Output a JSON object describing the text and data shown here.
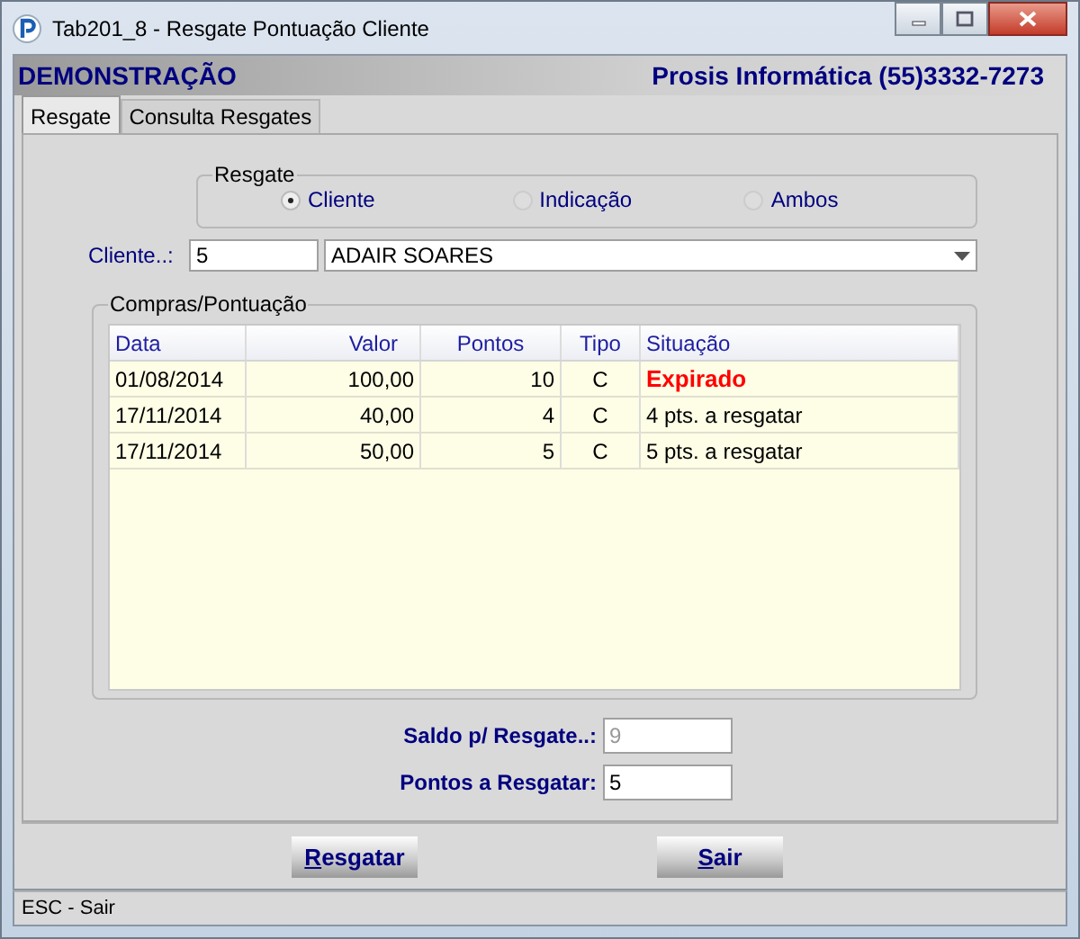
{
  "window": {
    "title": "Tab201_8 - Resgate Pontuação Cliente"
  },
  "header": {
    "left": "DEMONSTRAÇÃO",
    "right": "Prosis Informática (55)3332-7273"
  },
  "tabs": [
    {
      "label": "Resgate",
      "selected": true
    },
    {
      "label": "Consulta Resgates",
      "selected": false
    }
  ],
  "resgate_group": {
    "title": "Resgate",
    "options": [
      {
        "label": "Cliente",
        "selected": true
      },
      {
        "label": "Indicação",
        "selected": false
      },
      {
        "label": "Ambos",
        "selected": false
      }
    ]
  },
  "cliente": {
    "label": "Cliente..:",
    "code": "5",
    "name": "ADAIR SOARES"
  },
  "compras": {
    "title": "Compras/Pontuação",
    "columns": [
      "Data",
      "Valor",
      "Pontos",
      "Tipo",
      "Situação"
    ],
    "rows": [
      {
        "cells": [
          "01/08/2014",
          "100,00",
          "10",
          "C",
          "Expirado"
        ],
        "expired": true
      },
      {
        "cells": [
          "17/11/2014",
          "40,00",
          "4",
          "C",
          "4 pts. a resgatar"
        ],
        "expired": false
      },
      {
        "cells": [
          "17/11/2014",
          "50,00",
          "5",
          "C",
          "5 pts. a resgatar"
        ],
        "expired": false
      }
    ]
  },
  "fields": [
    {
      "label": "Saldo p/ Resgate..:",
      "value": "9",
      "disabled": true
    },
    {
      "label": "Pontos a Resgatar:",
      "value": "5",
      "disabled": false
    }
  ],
  "buttons": [
    {
      "label": "Resgatar",
      "underline_first": true
    },
    {
      "label": "Sair",
      "underline_first": true
    }
  ],
  "status_bar": "ESC - Sair"
}
